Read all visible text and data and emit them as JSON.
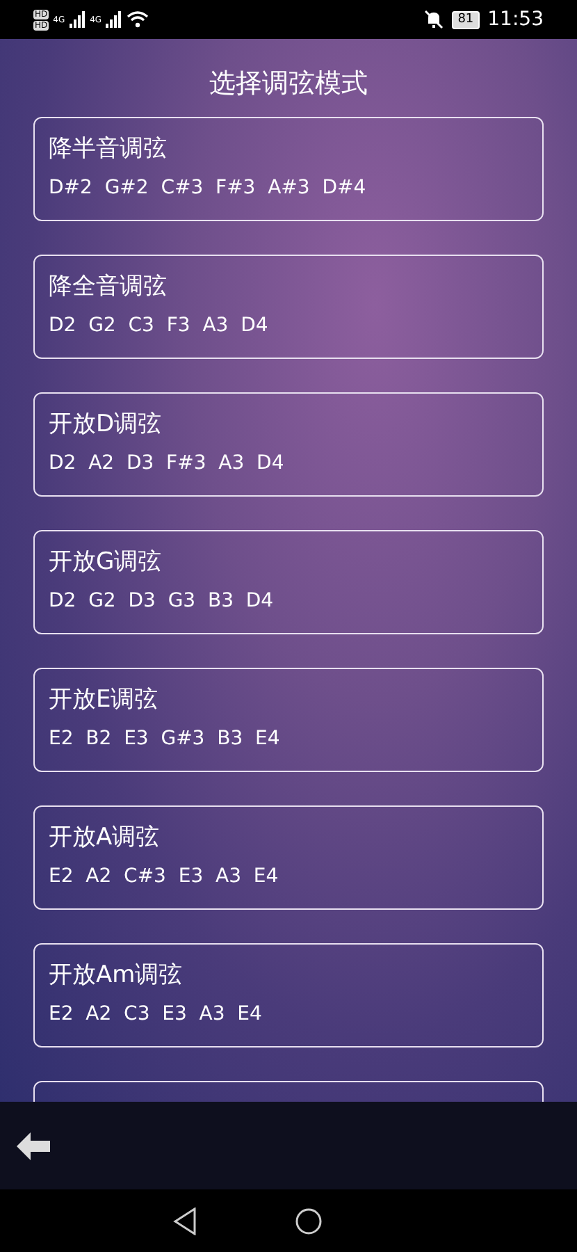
{
  "status_bar": {
    "sim_labels": [
      "HD",
      "HD"
    ],
    "network": [
      "4G",
      "4G"
    ],
    "battery": "81",
    "time": "11:53",
    "muted": true
  },
  "title": "选择调弦模式",
  "tunings": [
    {
      "name": "降半音调弦",
      "notes": "D#2  G#2  C#3  F#3  A#3  D#4"
    },
    {
      "name": "降全音调弦",
      "notes": "D2  G2  C3  F3  A3  D4"
    },
    {
      "name": "开放D调弦",
      "notes": "D2  A2  D3  F#3  A3  D4"
    },
    {
      "name": "开放G调弦",
      "notes": "D2  G2  D3  G3  B3  D4"
    },
    {
      "name": "开放E调弦",
      "notes": "E2  B2  E3  G#3  B3  E4"
    },
    {
      "name": "开放A调弦",
      "notes": "E2  A2  C#3  E3  A3  E4"
    },
    {
      "name": "开放Am调弦",
      "notes": "E2  A2  C3  E3  A3  E4"
    }
  ],
  "partial_card": true
}
